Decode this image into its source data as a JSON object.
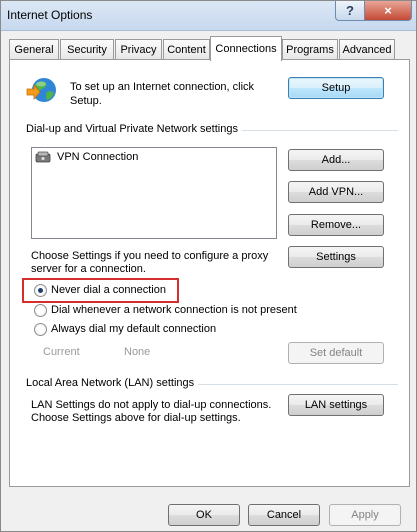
{
  "window": {
    "title": "Internet Options",
    "help_glyph": "?",
    "close_glyph": "×"
  },
  "tabs": [
    {
      "label": "General"
    },
    {
      "label": "Security"
    },
    {
      "label": "Privacy"
    },
    {
      "label": "Content"
    },
    {
      "label": "Connections",
      "active": true
    },
    {
      "label": "Programs"
    },
    {
      "label": "Advanced"
    }
  ],
  "setup": {
    "text": "To set up an Internet connection, click Setup.",
    "text_line1": "To set up an Internet connection, click",
    "text_line2": "Setup.",
    "button": "Setup"
  },
  "dialup": {
    "group_label": "Dial-up and Virtual Private Network settings",
    "connections": [
      {
        "name": "VPN Connection"
      }
    ],
    "add_button": "Add...",
    "add_vpn_button": "Add VPN...",
    "remove_button": "Remove...",
    "proxy_text_line1": "Choose Settings if you need to configure a proxy",
    "proxy_text_line2": "server for a connection.",
    "settings_button": "Settings",
    "options": [
      {
        "label": "Never dial a connection",
        "checked": true
      },
      {
        "label": "Dial whenever a network connection is not present",
        "checked": false
      },
      {
        "label": "Always dial my default connection",
        "checked": false
      }
    ],
    "current_label": "Current",
    "current_value": "None",
    "set_default_button": "Set default"
  },
  "lan": {
    "group_label": "Local Area Network (LAN) settings",
    "text_line1": "LAN Settings do not apply to dial-up connections.",
    "text_line2": "Choose Settings above for dial-up settings.",
    "button": "LAN settings"
  },
  "footer": {
    "ok": "OK",
    "cancel": "Cancel",
    "apply": "Apply"
  },
  "colors": {
    "highlight": "#d62e2e",
    "default_button_border": "#3c7fb1"
  }
}
